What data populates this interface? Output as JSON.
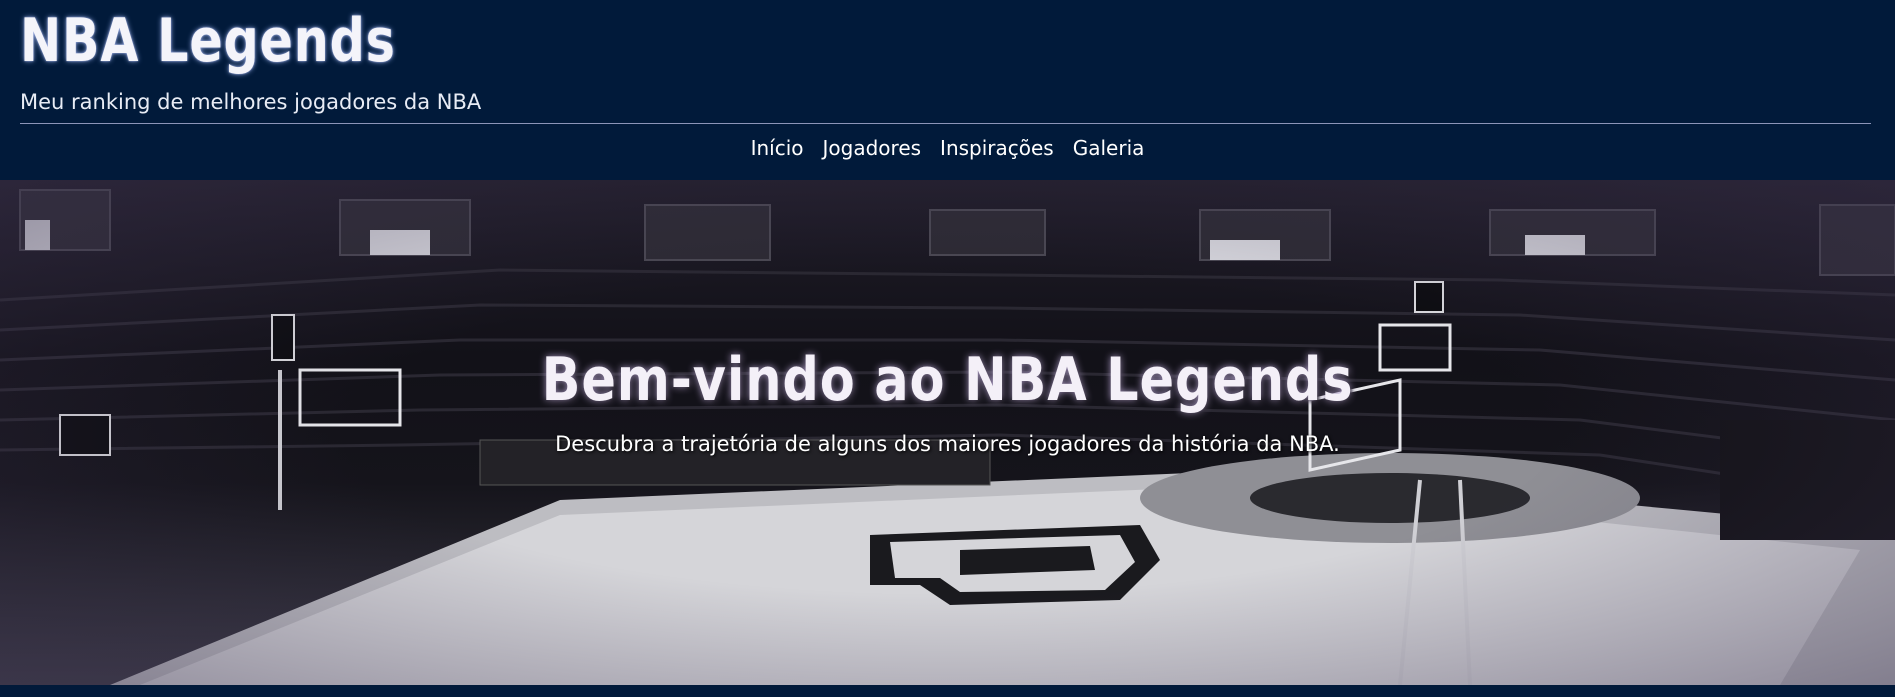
{
  "header": {
    "title": "NBA Legends",
    "subtitle": "Meu ranking de melhores jogadores da NBA"
  },
  "nav": {
    "items": [
      {
        "label": "Início"
      },
      {
        "label": "Jogadores"
      },
      {
        "label": "Inspirações"
      },
      {
        "label": "Galeria"
      }
    ]
  },
  "hero": {
    "title": "Bem-vindo ao NBA Legends",
    "text": "Descubra a trajetória de alguns dos maiores jogadores da história da NBA.",
    "image_alt": "Quadra de basquete em preto e branco"
  },
  "colors": {
    "header_bg": "#011a3a",
    "text": "#ffffff",
    "divider": "#8c95b8"
  }
}
